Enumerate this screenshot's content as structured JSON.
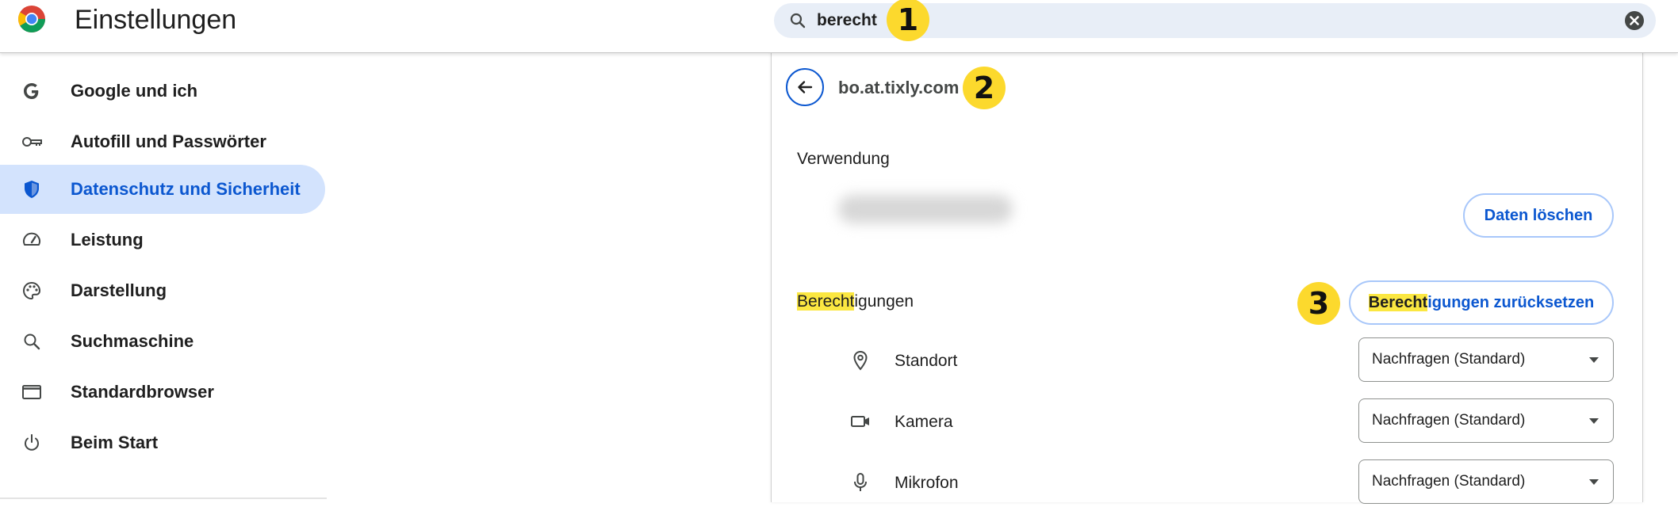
{
  "header": {
    "app_title": "Einstellungen",
    "logo_icon": "chrome-logo-icon",
    "search": {
      "value": "berecht",
      "search_icon": "search-icon",
      "clear_icon": "clear-icon"
    }
  },
  "badges": [
    "1",
    "2",
    "3"
  ],
  "sidebar": {
    "items": [
      {
        "label": "Google und ich",
        "icon": "google-g-icon",
        "active": false
      },
      {
        "label": "Autofill und Passwörter",
        "icon": "key-icon",
        "active": false
      },
      {
        "label": "Datenschutz und Sicherheit",
        "icon": "shield-icon",
        "active": true
      },
      {
        "label": "Leistung",
        "icon": "speedometer-icon",
        "active": false
      },
      {
        "label": "Darstellung",
        "icon": "palette-icon",
        "active": false
      },
      {
        "label": "Suchmaschine",
        "icon": "search-icon",
        "active": false
      },
      {
        "label": "Standardbrowser",
        "icon": "browser-window-icon",
        "active": false
      },
      {
        "label": "Beim Start",
        "icon": "power-icon",
        "active": false
      }
    ]
  },
  "site_details": {
    "back_icon": "back-arrow-icon",
    "site": "bo.at.tixly.com",
    "usage_heading": "Verwendung",
    "clear_data_button": "Daten löschen",
    "permissions_heading_match": "Berecht",
    "permissions_heading_rest": "igungen",
    "reset_button_match": "Berecht",
    "reset_button_rest": "igungen zurücksetzen",
    "permissions": [
      {
        "label": "Standort",
        "icon": "location-pin-icon",
        "value": "Nachfragen (Standard)"
      },
      {
        "label": "Kamera",
        "icon": "camera-icon",
        "value": "Nachfragen (Standard)"
      },
      {
        "label": "Mikrofon",
        "icon": "microphone-icon",
        "value": "Nachfragen (Standard)"
      }
    ]
  },
  "colors": {
    "accent": "#0b57d0",
    "active_nav_bg": "#d3e3fd",
    "search_bg": "#e8eef7",
    "highlight": "#fbe741",
    "badge": "#fcd92d"
  }
}
